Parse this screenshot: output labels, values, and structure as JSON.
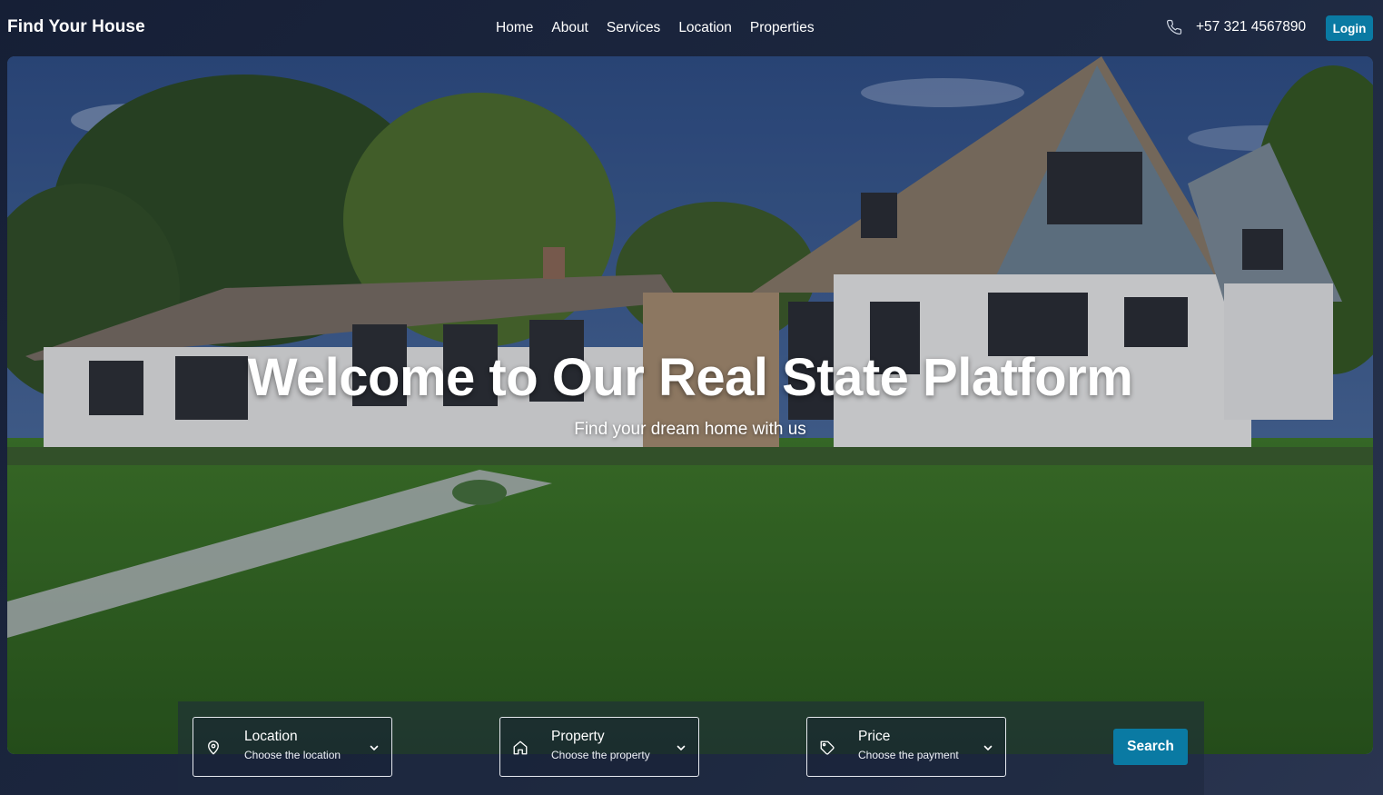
{
  "header": {
    "brand": "Find Your House",
    "nav": [
      "Home",
      "About",
      "Services",
      "Location",
      "Properties"
    ],
    "phone": "+57 321 4567890",
    "phone_icon": "phone-icon",
    "login_label": "Login"
  },
  "hero": {
    "title": "Welcome to Our Real State Platform",
    "subtitle": "Find your dream home with us",
    "image": "house-photo"
  },
  "search": {
    "fields": [
      {
        "label": "Location",
        "value": "Choose the location",
        "icon": "location-pin-icon"
      },
      {
        "label": "Property",
        "value": "Choose the property",
        "icon": "house-icon"
      },
      {
        "label": "Price",
        "value": "Choose the payment",
        "icon": "price-tag-icon"
      }
    ],
    "button_label": "Search"
  },
  "colors": {
    "accent": "#0a7aa3",
    "background": "#1d2840"
  }
}
